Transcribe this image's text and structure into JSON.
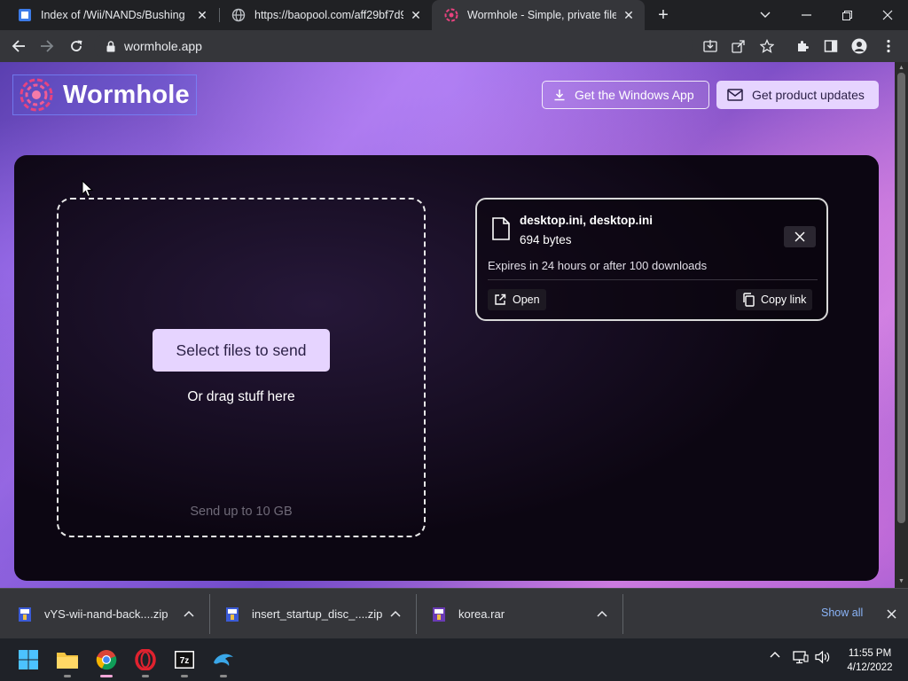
{
  "browser": {
    "tabs": [
      {
        "title": "Index of /Wii/NANDs/Bushing",
        "favicon": "blue-square-icon",
        "active": false
      },
      {
        "title": "https://baopool.com/aff29bf7d9",
        "favicon": "globe-icon",
        "active": false
      },
      {
        "title": "Wormhole - Simple, private file sh",
        "favicon": "wormhole-logo-icon",
        "active": true
      }
    ],
    "url": "wormhole.app"
  },
  "page": {
    "brand_name": "Wormhole",
    "header_buttons": {
      "windows_app": "Get the Windows App",
      "product_updates": "Get product updates"
    },
    "upload": {
      "select_label": "Select files to send",
      "drag_label": "Or drag stuff here",
      "limit_label": "Send up to 10 GB"
    },
    "file_card": {
      "file_names": "desktop.ini, desktop.ini",
      "size": "694 bytes",
      "expires": "Expires in 24 hours or after 100 downloads",
      "open_label": "Open",
      "copy_label": "Copy link"
    },
    "colors": {
      "accent": "#e6d4ff",
      "panel": "#0e0813",
      "link": "#8ab4f8"
    }
  },
  "downloads": {
    "items": [
      {
        "name": "vYS-wii-nand-back....zip",
        "icon": "winrar-zip-icon"
      },
      {
        "name": "insert_startup_disc_....zip",
        "icon": "winrar-zip-icon"
      },
      {
        "name": "korea.rar",
        "icon": "winrar-archive-icon"
      }
    ],
    "show_all": "Show all"
  },
  "taskbar": {
    "apps": [
      "windows-start-icon",
      "file-explorer-icon",
      "chrome-icon",
      "opera-icon",
      "7zip-icon",
      "dolphin-emulator-icon"
    ],
    "time": "11:55 PM",
    "date": "4/12/2022"
  }
}
